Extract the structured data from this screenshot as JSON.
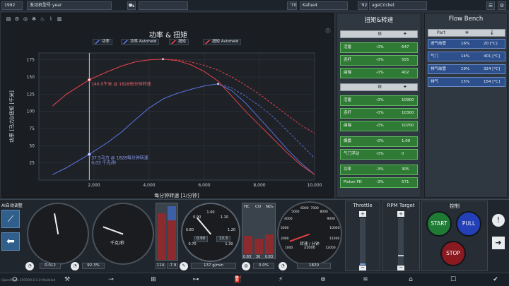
{
  "topbar": {
    "year": "1992",
    "engine_label": "发动机型号 year",
    "year2": "'70",
    "engine_name": "Kafue4",
    "year3": "'92",
    "car_name": "ageCricket"
  },
  "chart_data": {
    "type": "line",
    "title": "功率 & 扭矩",
    "xlabel": "每分钟转速 [1/分钟]",
    "ylabel": "功率 [马力]/扭矩 [千米]",
    "xlim": [
      0,
      10000
    ],
    "ylim": [
      0,
      185
    ],
    "xticks": [
      2000,
      4000,
      6000,
      8000,
      10000
    ],
    "xtick_labels": [
      "2,000",
      "4,000",
      "6,000",
      "8,000",
      "10,000"
    ],
    "yticks": [
      25,
      50,
      75,
      100,
      125,
      150,
      175
    ],
    "grid": true,
    "legend": [
      "功率",
      "功率 Autoheld",
      "扭矩",
      "扭矩 Autoheld"
    ],
    "series": [
      {
        "name": "功率",
        "color": "#5a6fd8",
        "dash": false,
        "x": [
          500,
          1000,
          1828,
          2500,
          3000,
          3500,
          4000,
          4500,
          5000,
          5500,
          6000,
          6500,
          7000,
          7500,
          8000,
          8500,
          9000,
          9500,
          10000
        ],
        "y": [
          8,
          18,
          37.5,
          55,
          70,
          88,
          105,
          118,
          126,
          132,
          137,
          140,
          130,
          112,
          90,
          68,
          45,
          25,
          8
        ]
      },
      {
        "name": "功率 Autoheld",
        "color": "#5a6fd8",
        "dash": true,
        "x": [
          500,
          1000,
          1828,
          2500,
          3000,
          3500,
          4000,
          4500,
          5000,
          5500,
          6000,
          6500,
          7000,
          7500,
          8000,
          8500,
          9000,
          9500,
          10000
        ],
        "y": [
          8,
          18,
          37.5,
          55,
          70,
          88,
          105,
          118,
          126,
          132,
          137,
          140,
          134,
          122,
          108,
          92,
          72,
          52,
          32
        ]
      },
      {
        "name": "扭矩",
        "color": "#e0404a",
        "dash": false,
        "x": [
          500,
          1000,
          1828,
          2500,
          3000,
          3500,
          4000,
          4500,
          5000,
          5500,
          6000,
          6500,
          7000,
          7500,
          8000,
          8500,
          9000,
          9500,
          10000
        ],
        "y": [
          108,
          125,
          146,
          158,
          166,
          172,
          175,
          176,
          174,
          168,
          158,
          144,
          122,
          100,
          80,
          60,
          40,
          22,
          8
        ]
      },
      {
        "name": "扭矩 Autoheld",
        "color": "#e0404a",
        "dash": true,
        "x": [
          500,
          1000,
          1828,
          2500,
          3000,
          3500,
          4000,
          4500,
          5000,
          5500,
          6000,
          6500,
          7000,
          7500,
          8000,
          8500,
          9000,
          9500,
          10000
        ],
        "y": [
          108,
          125,
          146,
          158,
          166,
          172,
          175,
          176,
          175,
          172,
          167,
          160,
          150,
          138,
          125,
          110,
          95,
          80,
          68
        ]
      }
    ],
    "marker_rpm": 1828,
    "annotations": {
      "torque": "146.0牛米 @ 1828每分钟转速",
      "power": "37.5马力 @ 1828每分钟转速",
      "fuel": "0.03 千克/秒"
    }
  },
  "torque_panel": {
    "title": "扭矩&转速",
    "rows1": [
      {
        "name": "活塞",
        "pct": "-0%",
        "val": "647"
      },
      {
        "name": "连杆",
        "pct": "-0%",
        "val": "555"
      },
      {
        "name": "曲轴",
        "pct": "-0%",
        "val": "402"
      }
    ],
    "rows2": [
      {
        "name": "活塞",
        "pct": "-0%",
        "val": "10900"
      },
      {
        "name": "连杆",
        "pct": "-0%",
        "val": "10300"
      },
      {
        "name": "曲轴",
        "pct": "-0%",
        "val": "10700"
      }
    ],
    "rows3": [
      {
        "name": "爆震",
        "pct": "-0%",
        "val": "1.00"
      },
      {
        "name": "气门浮动",
        "pct": "-0%",
        "val": "0"
      }
    ],
    "rows4": [
      {
        "name": "功率",
        "pct": "-3%",
        "val": "305"
      },
      {
        "name": "Piston PD",
        "pct": "-3%",
        "val": "571"
      }
    ]
  },
  "flow_panel": {
    "title": "Flow Bench",
    "col_part": "Part",
    "rows": [
      {
        "name": "进气歧管",
        "pct": "16%",
        "val": "20 [°C]"
      },
      {
        "name": "气门",
        "pct": "14%",
        "val": "401 [°C]"
      },
      {
        "name": "排气歧管",
        "pct": "19%",
        "val": "324 [°C]"
      },
      {
        "name": "排气",
        "pct": "15%",
        "val": "154 [°C]"
      }
    ]
  },
  "bottom": {
    "ai_label": "AI自动调整",
    "g1_value": "0.012",
    "g2_value": "92.3%",
    "g2_unit": "千克/秒",
    "bar_values": [
      "114",
      "-7.9"
    ],
    "boost_ticks": [
      "0.70",
      "0.80",
      "0.90",
      "1.00",
      "1.10",
      "1.20",
      "1.30"
    ],
    "boost_vals": [
      "0.90",
      "13.3"
    ],
    "emission_value": "137 g/min",
    "hc_co_nox": [
      "HC",
      "CO",
      "NOₓ"
    ],
    "emission_nums": [
      "0.83",
      "30",
      "0.83"
    ],
    "emission_pct": "0.0%",
    "rpm_label": "转速 / 分钟",
    "rpm_sub": "x1000",
    "rpm_value": "1820",
    "rpm_ticks": [
      "1000",
      "2000",
      "3000",
      "4000",
      "5000",
      "6000",
      "7000",
      "8000",
      "9000",
      "10000",
      "11000",
      "12000"
    ],
    "throttle_label": "Throttle",
    "rpm_target_label": "RPM Target",
    "control_label": "控制",
    "start": "START",
    "pull": "PULL",
    "stop": "STOP",
    "version": "OpenMode 250709.0.1.0 Modeled"
  },
  "colors": {
    "power": "#5a6fd8",
    "torque": "#e0404a",
    "start": "#1f7a34",
    "pull": "#2340b8",
    "stop": "#8a1a20",
    "green_row": "#2f7a34",
    "blue_row": "#2d4f8c"
  }
}
